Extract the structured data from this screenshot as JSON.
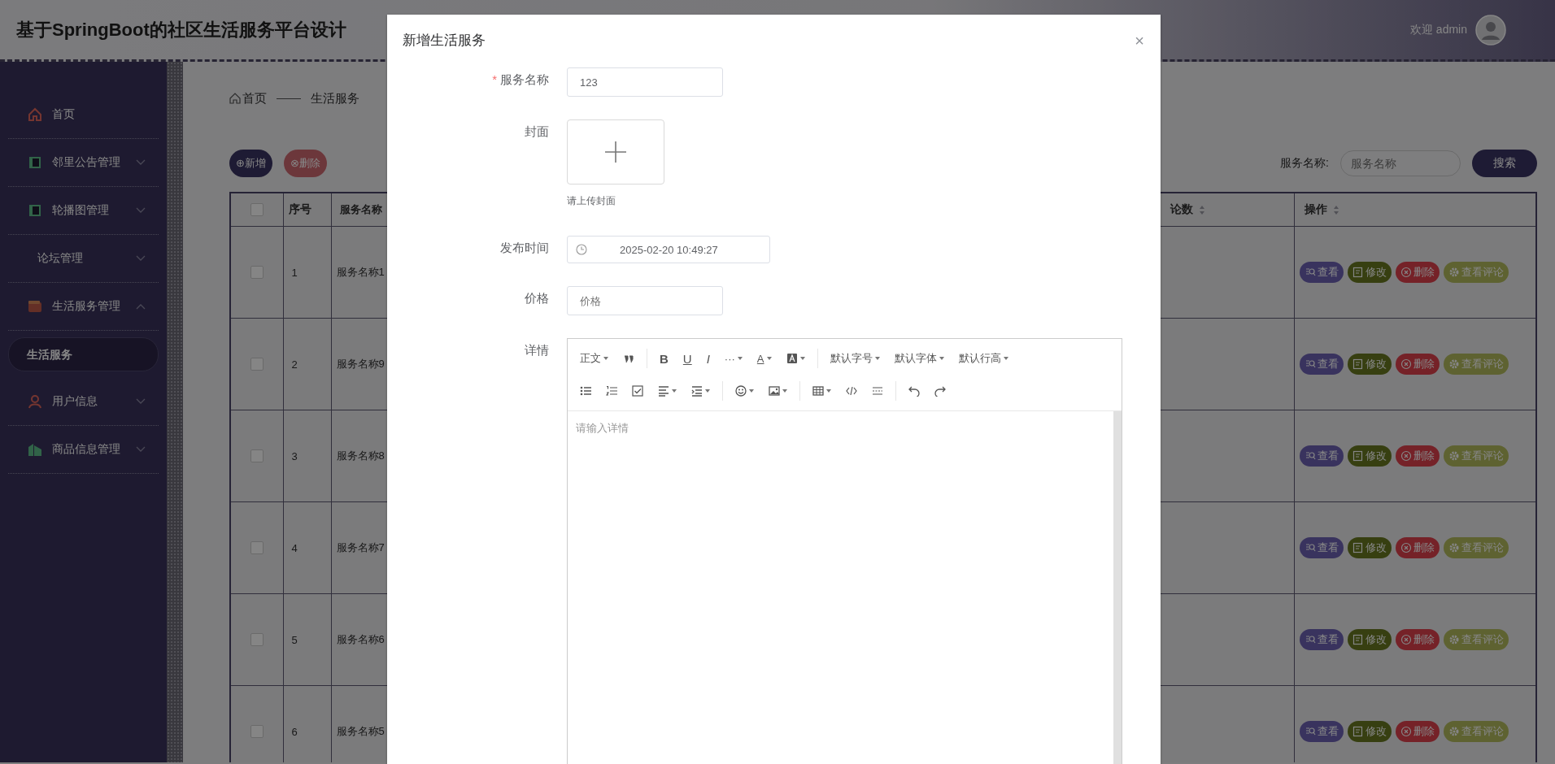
{
  "header": {
    "title": "基于SpringBoot的社区生活服务平台设计",
    "welcome": "欢迎 admin"
  },
  "sidebar": {
    "items": [
      {
        "label": "首页",
        "kind": "link",
        "selected": false
      },
      {
        "label": "邻里公告管理",
        "kind": "group",
        "expanded": false,
        "selected": false
      },
      {
        "label": "轮播图管理",
        "kind": "group",
        "expanded": false,
        "selected": false
      },
      {
        "label": "论坛管理",
        "kind": "group",
        "expanded": false,
        "selected": false
      },
      {
        "label": "生活服务管理",
        "kind": "group",
        "expanded": true,
        "selected": false,
        "children": [
          {
            "label": "生活服务",
            "selected": true
          }
        ]
      },
      {
        "label": "用户信息",
        "kind": "group",
        "expanded": false,
        "selected": false
      },
      {
        "label": "商品信息管理",
        "kind": "group",
        "expanded": false,
        "selected": false
      }
    ]
  },
  "breadcrumb": [
    "首页",
    "生活服务"
  ],
  "toolbar": {
    "add": "⊕新增",
    "delete": "⊗删除",
    "search_label": "服务名称:",
    "search_placeholder": "服务名称",
    "search_button": "搜索"
  },
  "table": {
    "header_checked": false,
    "columns": [
      "序号",
      "服务名称",
      "论数",
      "操作"
    ],
    "rows": [
      {
        "checked": false,
        "index": "1",
        "name": "服务名称1",
        "actions": [
          "查看",
          "修改",
          "删除",
          "查看评论"
        ]
      },
      {
        "checked": false,
        "index": "2",
        "name": "服务名称9",
        "actions": [
          "查看",
          "修改",
          "删除",
          "查看评论"
        ]
      },
      {
        "checked": false,
        "index": "3",
        "name": "服务名称8",
        "actions": [
          "查看",
          "修改",
          "删除",
          "查看评论"
        ]
      },
      {
        "checked": false,
        "index": "4",
        "name": "服务名称7",
        "actions": [
          "查看",
          "修改",
          "删除",
          "查看评论"
        ]
      },
      {
        "checked": false,
        "index": "5",
        "name": "服务名称6",
        "actions": [
          "查看",
          "修改",
          "删除",
          "查看评论"
        ]
      },
      {
        "checked": false,
        "index": "6",
        "name": "服务名称5",
        "actions": [
          "查看",
          "修改",
          "删除",
          "查看评论"
        ]
      }
    ]
  },
  "dialog": {
    "title": "新增生活服务",
    "close": "×",
    "required_mark": "*",
    "fields": [
      {
        "kind": "text",
        "label": "服务名称",
        "required": true,
        "value": "123"
      },
      {
        "kind": "upload",
        "label": "封面",
        "required": false,
        "hint": "请上传封面"
      },
      {
        "kind": "datetime",
        "label": "发布时间",
        "required": false,
        "value": "2025-02-20 10:49:27"
      },
      {
        "kind": "text",
        "label": "价格",
        "required": false,
        "placeholder": "价格"
      },
      {
        "kind": "editor",
        "label": "详情",
        "required": false,
        "placeholder": "请输入详情"
      }
    ],
    "editor_toolbar": [
      [
        {
          "kind": "dropdown",
          "label": "正文"
        },
        {
          "kind": "quote"
        },
        {
          "kind": "separator"
        },
        {
          "kind": "glyph",
          "label": "B"
        },
        {
          "kind": "glyph",
          "label": "U"
        },
        {
          "kind": "glyph",
          "label": "I"
        },
        {
          "kind": "dropdown",
          "label": "···"
        },
        {
          "kind": "glyph-dropdown",
          "label": "A"
        },
        {
          "kind": "bg-color"
        },
        {
          "kind": "separator"
        },
        {
          "kind": "dropdown",
          "label": "默认字号"
        },
        {
          "kind": "dropdown",
          "label": "默认字体"
        },
        {
          "kind": "dropdown",
          "label": "默认行高"
        }
      ],
      [
        {
          "kind": "bullet-list"
        },
        {
          "kind": "numbered-list"
        },
        {
          "kind": "todo"
        },
        {
          "kind": "align"
        },
        {
          "kind": "indent"
        },
        {
          "kind": "separator"
        },
        {
          "kind": "emoji"
        },
        {
          "kind": "image"
        },
        {
          "kind": "separator"
        },
        {
          "kind": "table"
        },
        {
          "kind": "code"
        },
        {
          "kind": "divider"
        },
        {
          "kind": "separator"
        },
        {
          "kind": "undo"
        },
        {
          "kind": "redo"
        }
      ]
    ]
  }
}
